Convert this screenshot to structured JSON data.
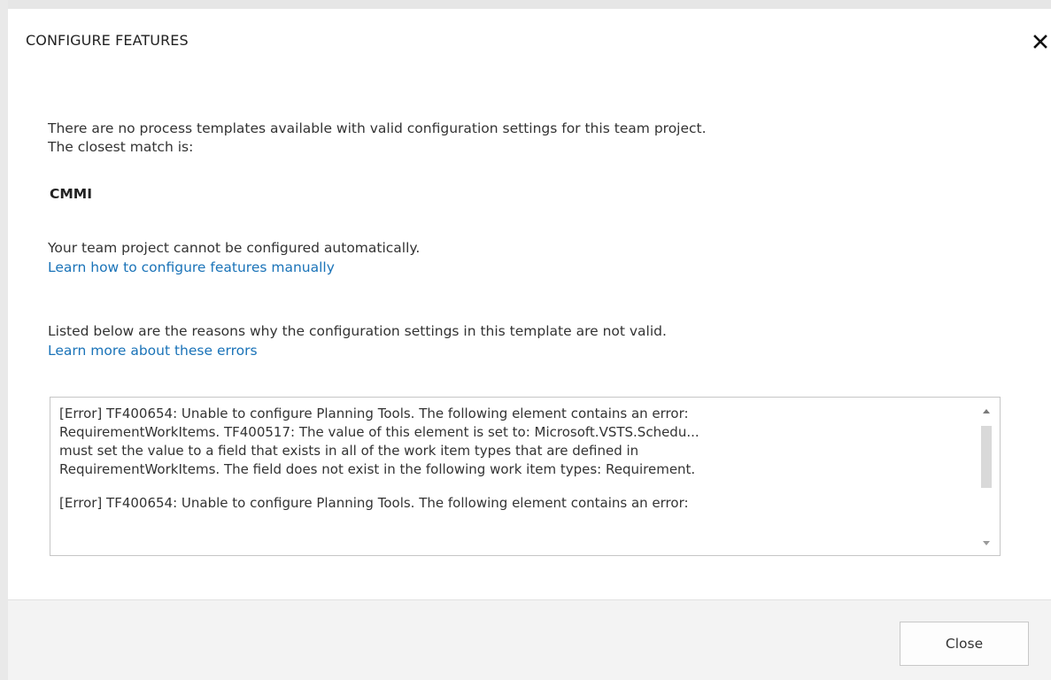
{
  "dialog": {
    "title": "CONFIGURE FEATURES",
    "close_icon": "close-icon"
  },
  "content": {
    "no_templates_line1": "There are no process templates available with valid configuration settings for this team project.",
    "no_templates_line2": "The closest match is:",
    "closest_match": "CMMI",
    "cannot_configure": "Your team project cannot be configured automatically.",
    "learn_configure_link": "Learn how to configure features manually",
    "reasons_intro": "Listed below are the reasons why the configuration settings in this template are not valid.",
    "learn_errors_link": "Learn more about these errors"
  },
  "errors": [
    "[Error] TF400654: Unable to configure Planning Tools. The following element contains an error:\nRequirementWorkItems. TF400517: The value of this element is set to: Microsoft.VSTS.Schedu...\nmust set the value to a field that exists in all of the work item types that are defined in\nRequirementWorkItems. The field does not exist in the following work item types: Requirement.",
    "[Error] TF400654: Unable to configure Planning Tools. The following element contains an error:"
  ],
  "scrollbar": {
    "up_icon": "scroll-up-arrow-icon",
    "down_icon": "scroll-down-arrow-icon"
  },
  "footer": {
    "close_label": "Close"
  },
  "colors": {
    "link": "#1a73b8",
    "footer_bg": "#f3f3f3",
    "text": "#333333"
  }
}
